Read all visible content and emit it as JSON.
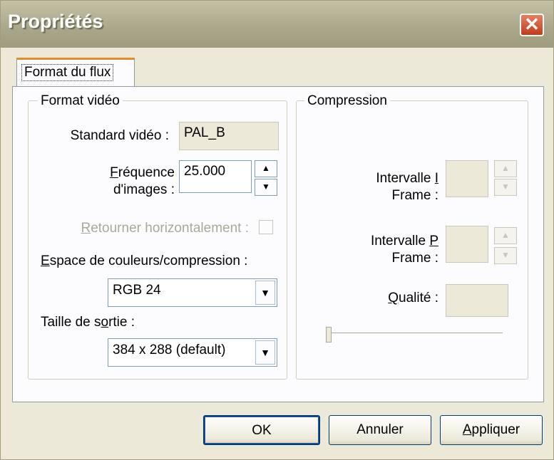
{
  "window": {
    "title": "Propriétés",
    "close_glyph": "✕"
  },
  "tabs": [
    {
      "label": "Format du flux",
      "selected": true
    }
  ],
  "video_group": {
    "title": "Format vidéo",
    "standard_label": "Standard vidéo :",
    "standard_value": "PAL_B",
    "framerate_label_pre": "F",
    "framerate_label_line1": "réquence",
    "framerate_label_line2": "d'images :",
    "framerate_value": "25.000",
    "flip_label_pre": "R",
    "flip_label_rest": "etourner horizontalement :",
    "flip_checked": false,
    "colorspace_label_pre": "E",
    "colorspace_label_rest": "space de couleurs/compression :",
    "colorspace_value": "RGB 24",
    "output_size_label_a": "Taille de s",
    "output_size_label_u": "o",
    "output_size_label_b": "rtie :",
    "output_size_value": "384 x 288  (default)"
  },
  "compression_group": {
    "title": "Compression",
    "iframe_label_a": "Intervalle ",
    "iframe_label_u": "I",
    "iframe_label_b": "Frame :",
    "pframe_label_a": "Intervalle ",
    "pframe_label_u": "P",
    "pframe_label_b": "Frame :",
    "quality_label_u": "Q",
    "quality_label_rest": "ualité :",
    "quality_slider_fraction": 0
  },
  "buttons": {
    "ok": "OK",
    "cancel": "Annuler",
    "apply_u": "A",
    "apply_rest": "ppliquer"
  },
  "icons": {
    "spin_up": "▲",
    "spin_down": "▼",
    "dropdown": "▼"
  },
  "colors": {
    "accent_tab": "#e68b2c",
    "title_bar": "#a9a68a",
    "close_button": "#c43a18"
  }
}
